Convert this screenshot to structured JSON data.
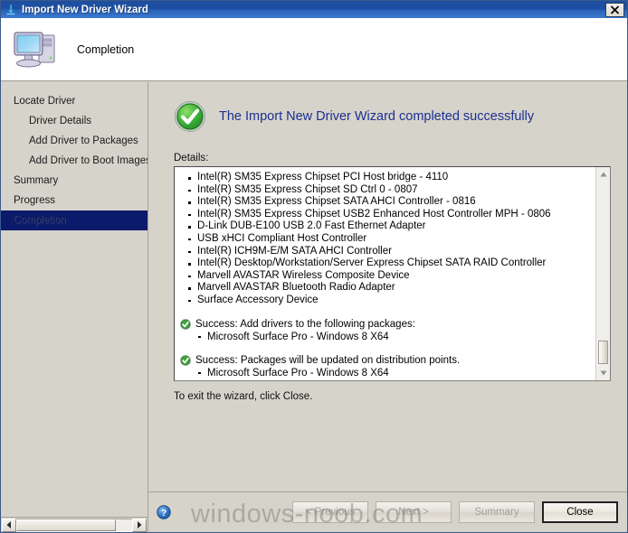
{
  "window": {
    "title": "Import New Driver Wizard",
    "title_icon": "import-arrow-icon",
    "close_label": "Close window"
  },
  "header": {
    "icon": "computer-icon",
    "title": "Completion"
  },
  "sidebar": {
    "items": [
      {
        "label": "Locate Driver",
        "level": 1,
        "selected": false
      },
      {
        "label": "Driver Details",
        "level": 2,
        "selected": false
      },
      {
        "label": "Add Driver to Packages",
        "level": 2,
        "selected": false
      },
      {
        "label": "Add Driver to Boot Images",
        "level": 2,
        "selected": false
      },
      {
        "label": "Summary",
        "level": 1,
        "selected": false
      },
      {
        "label": "Progress",
        "level": 1,
        "selected": false
      },
      {
        "label": "Completion",
        "level": 1,
        "selected": true
      }
    ]
  },
  "main": {
    "success_icon": "green-check-circle-icon",
    "success_heading": "The Import New Driver Wizard completed successfully",
    "details_label": "Details:",
    "drivers": [
      "Intel(R) SM35 Express Chipset PCI Host bridge - 4110",
      "Intel(R) SM35 Express Chipset SD Ctrl 0 - 0807",
      "Intel(R) SM35 Express Chipset SATA AHCI Controller - 0816",
      "Intel(R) SM35 Express Chipset USB2 Enhanced Host Controller MPH - 0806",
      "D-Link DUB-E100 USB 2.0 Fast Ethernet Adapter",
      "USB xHCI Compliant Host Controller",
      "Intel(R) ICH9M-E/M SATA AHCI Controller",
      "Intel(R) Desktop/Workstation/Server Express Chipset SATA RAID Controller",
      "Marvell AVASTAR Wireless Composite Device",
      "Marvell AVASTAR Bluetooth Radio Adapter",
      "Surface Accessory Device"
    ],
    "results": [
      {
        "icon": "small-green-check-icon",
        "heading": "Success: Add drivers to the following packages:",
        "items": [
          "Microsoft Surface Pro - Windows 8 X64"
        ]
      },
      {
        "icon": "small-green-check-icon",
        "heading": "Success: Packages will be updated on distribution points.",
        "items": [
          "Microsoft Surface Pro - Windows 8 X64"
        ]
      }
    ],
    "exit_note": "To exit the wizard, click Close."
  },
  "footer": {
    "help_icon": "help-question-icon",
    "buttons": [
      {
        "label": "< Previous",
        "enabled": false,
        "default": false
      },
      {
        "label": "Next >",
        "enabled": false,
        "default": false
      },
      {
        "label": "Summary",
        "enabled": false,
        "default": false
      },
      {
        "label": "Close",
        "enabled": true,
        "default": true
      }
    ]
  },
  "watermark": "windows-noob.com",
  "colors": {
    "titlebar_blue": "#1c4fa3",
    "heading_blue": "#1b2f93",
    "selection_navy": "#0c1a6b",
    "success_green": "#2f9e2f",
    "dialog_face": "#d6d3ca"
  }
}
